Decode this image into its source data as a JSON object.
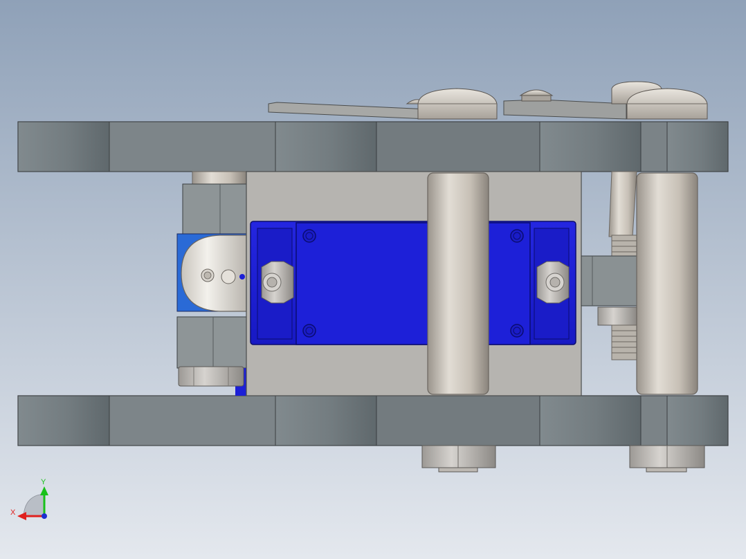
{
  "viewport": {
    "background_top": "#8fa1b8",
    "background_bottom": "#e4e8ee"
  },
  "colors": {
    "plate": "#717b7f",
    "plate_edge": "#3a3e40",
    "bracket": "#b4b2ae",
    "servo_body": "#1c1fd6",
    "servo_dark": "#0f1396",
    "standoff": "#c9c2b8",
    "hardware": "#a9a9a6"
  },
  "triad": {
    "x_label": "X",
    "y_label": "Y",
    "x_color": "#e0201e",
    "y_color": "#19c11a",
    "z_color": "#1d2fd0"
  }
}
